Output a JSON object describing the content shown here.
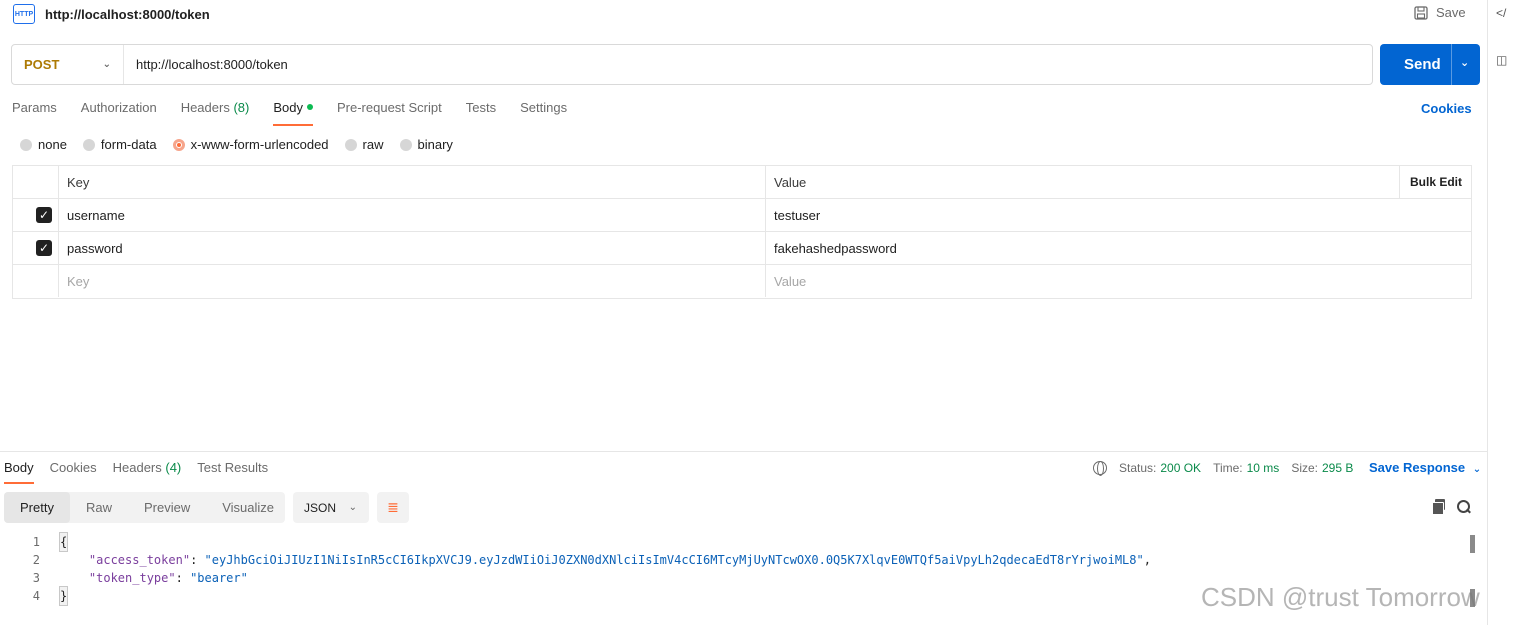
{
  "header": {
    "http_badge": "HTTP",
    "title": "http://localhost:8000/token",
    "save_label": "Save"
  },
  "request": {
    "method": "POST",
    "url": "http://localhost:8000/token",
    "send_label": "Send"
  },
  "request_tabs": [
    {
      "label": "Params"
    },
    {
      "label": "Authorization"
    },
    {
      "label": "Headers",
      "count": "(8)"
    },
    {
      "label": "Body"
    },
    {
      "label": "Pre-request Script"
    },
    {
      "label": "Tests"
    },
    {
      "label": "Settings"
    }
  ],
  "cookies_label": "Cookies",
  "body_types": {
    "none": "none",
    "form_data": "form-data",
    "urlencoded": "x-www-form-urlencoded",
    "raw": "raw",
    "binary": "binary",
    "selected": "x-www-form-urlencoded"
  },
  "kv_table": {
    "key_header": "Key",
    "value_header": "Value",
    "bulk_edit": "Bulk Edit",
    "rows": [
      {
        "key": "username",
        "value": "testuser",
        "checked": true
      },
      {
        "key": "password",
        "value": "fakehashedpassword",
        "checked": true
      }
    ],
    "key_placeholder": "Key",
    "value_placeholder": "Value"
  },
  "response_tabs": {
    "body": "Body",
    "cookies": "Cookies",
    "headers": "Headers",
    "headers_count": "(4)",
    "test_results": "Test Results"
  },
  "response_status": {
    "status_label": "Status:",
    "status_value": "200 OK",
    "time_label": "Time:",
    "time_value": "10 ms",
    "size_label": "Size:",
    "size_value": "295 B",
    "save_response": "Save Response"
  },
  "format_tabs": {
    "pretty": "Pretty",
    "raw": "Raw",
    "preview": "Preview",
    "visualize": "Visualize"
  },
  "format_select": "JSON",
  "response_body": {
    "line_numbers": [
      "1",
      "2",
      "3",
      "4"
    ],
    "open_brace": "{",
    "close_brace": "}",
    "access_token_key": "\"access_token\"",
    "access_token_value": "\"eyJhbGciOiJIUzI1NiIsInR5cCI6IkpXVCJ9.eyJzdWIiOiJ0ZXN0dXNlciIsImV4cCI6MTcyMjUyNTcwOX0.0Q5K7XlqvE0WTQf5aiVpyLh2qdecaEdT8rYrjwoiML8\"",
    "token_type_key": "\"token_type\"",
    "token_type_value": "\"bearer\""
  },
  "watermark": "CSDN @trust Tomorrow",
  "colors": {
    "send": "#0265d2",
    "active_tab": "#ff6c37",
    "method": "#ad7a03",
    "status_ok": "#0a8a4a"
  }
}
